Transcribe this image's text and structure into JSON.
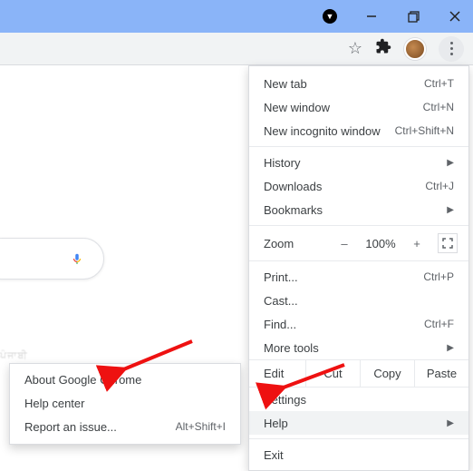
{
  "window": {
    "minimize": "—",
    "maximize": "❐",
    "close": "✕"
  },
  "toolbar": {
    "star": "☆",
    "extension": "★"
  },
  "menu": {
    "new_tab": {
      "label": "New tab",
      "shortcut": "Ctrl+T"
    },
    "new_window": {
      "label": "New window",
      "shortcut": "Ctrl+N"
    },
    "incognito": {
      "label": "New incognito window",
      "shortcut": "Ctrl+Shift+N"
    },
    "history": {
      "label": "History"
    },
    "downloads": {
      "label": "Downloads",
      "shortcut": "Ctrl+J"
    },
    "bookmarks": {
      "label": "Bookmarks"
    },
    "zoom": {
      "label": "Zoom",
      "minus": "–",
      "value": "100%",
      "plus": "+"
    },
    "print": {
      "label": "Print...",
      "shortcut": "Ctrl+P"
    },
    "cast": {
      "label": "Cast..."
    },
    "find": {
      "label": "Find...",
      "shortcut": "Ctrl+F"
    },
    "more_tools": {
      "label": "More tools"
    },
    "edit": {
      "label": "Edit",
      "cut": "Cut",
      "copy": "Copy",
      "paste": "Paste"
    },
    "settings": {
      "label": "Settings"
    },
    "help": {
      "label": "Help"
    },
    "exit": {
      "label": "Exit"
    }
  },
  "help_submenu": {
    "about": {
      "label": "About Google Chrome"
    },
    "help_center": {
      "label": "Help center"
    },
    "report": {
      "label": "Report an issue...",
      "shortcut": "Alt+Shift+I"
    }
  }
}
